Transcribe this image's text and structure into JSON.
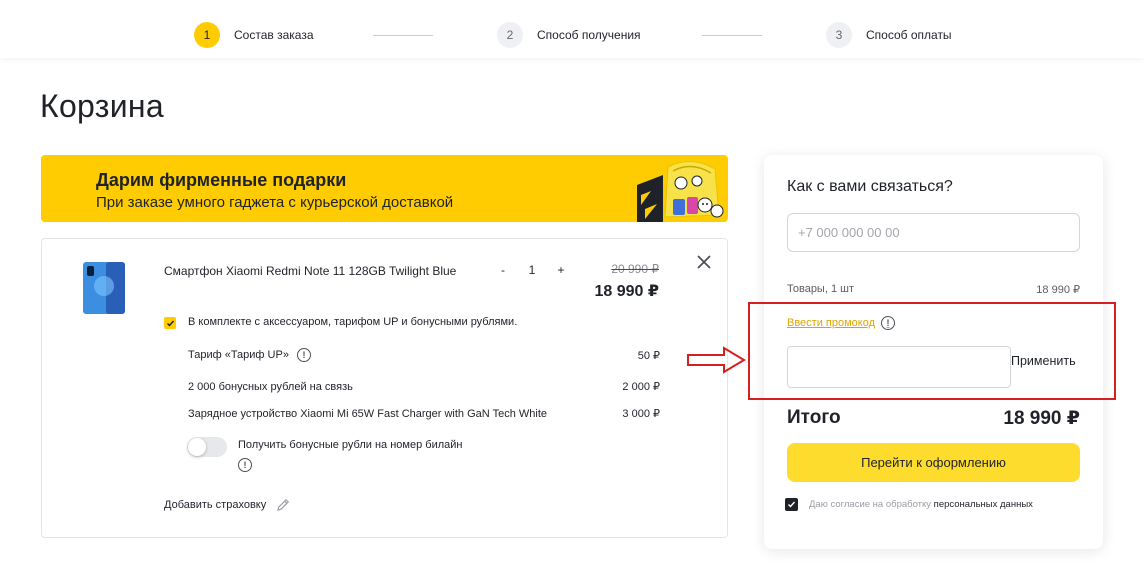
{
  "stepper": {
    "steps": [
      {
        "num": "1",
        "label": "Состав заказа"
      },
      {
        "num": "2",
        "label": "Способ получения"
      },
      {
        "num": "3",
        "label": "Способ оплаты"
      }
    ]
  },
  "page_title": "Корзина",
  "banner": {
    "title": "Дарим фирменные подарки",
    "subtitle": "При заказе умного гаджета с курьерской доставкой"
  },
  "product": {
    "name": "Смартфон Xiaomi Redmi Note 11 128GB Twilight Blue",
    "qty_minus": "-",
    "qty": "1",
    "qty_plus": "+",
    "old_price": "20 990 ₽",
    "price": "18 990 ₽",
    "bundle_label": "В комплекте с аксессуаром, тарифом UP и бонусными рублями.",
    "bundle_items": [
      {
        "label": "Тариф «Тариф UP»",
        "price": "50 ₽"
      },
      {
        "label": "2 000 бонусных рублей на связь",
        "price": "2 000 ₽"
      },
      {
        "label": "Зарядное устройство Xiaomi Mi 65W Fast Charger with GaN Tech White",
        "price": "3 000 ₽"
      }
    ],
    "toggle_label": "Получить бонусные рубли на номер билайн",
    "insurance_label": "Добавить страховку"
  },
  "side": {
    "contact_title": "Как с вами связаться?",
    "phone_placeholder": "+7 000 000 00 00",
    "goods_label": "Товары, 1 шт",
    "goods_value": "18 990 ₽",
    "promo_link": "Ввести промокод",
    "apply_label": "Применить",
    "total_label": "Итого",
    "total_value": "18 990 ₽",
    "checkout_label": "Перейти к оформлению",
    "consent_text": "Даю согласие на обработку ",
    "consent_link": "персональных данных"
  },
  "colors": {
    "brand_yellow": "#fecc00",
    "button_yellow": "#fddc2d",
    "promo_link": "#e0a400",
    "highlight_red": "#d42020"
  }
}
